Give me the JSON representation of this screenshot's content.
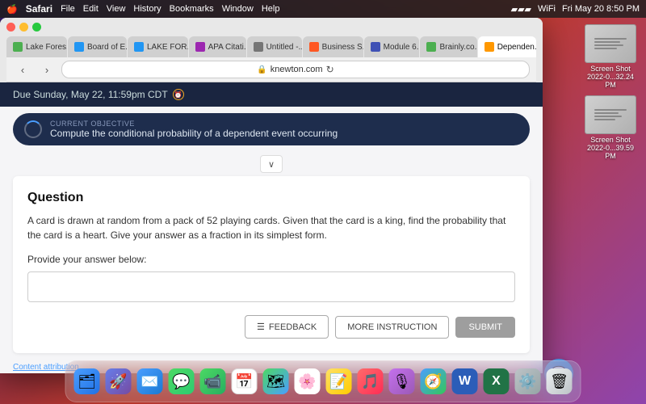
{
  "menubar": {
    "apple": "🍎",
    "app_name": "Safari",
    "menus": [
      "File",
      "Edit",
      "View",
      "History",
      "Bookmarks",
      "Window",
      "Help"
    ],
    "right_icons": [
      "battery",
      "wifi",
      "time"
    ],
    "time": "Fri May 20  8:50 PM"
  },
  "browser": {
    "tabs": [
      {
        "id": "lake",
        "label": "Lake Fores...",
        "active": false,
        "favicon_color": "#4CAF50"
      },
      {
        "id": "board",
        "label": "Board of E...",
        "active": false,
        "favicon_color": "#2196F3"
      },
      {
        "id": "lake2",
        "label": "LAKE FOR...",
        "active": false,
        "favicon_color": "#2196F3"
      },
      {
        "id": "apa",
        "label": "APA Citati...",
        "active": false,
        "favicon_color": "#9C27B0"
      },
      {
        "id": "untitled",
        "label": "Untitled -...",
        "active": false,
        "favicon_color": "#757575"
      },
      {
        "id": "business",
        "label": "Business S...",
        "active": false,
        "favicon_color": "#FF5722"
      },
      {
        "id": "module",
        "label": "Module 6...",
        "active": false,
        "favicon_color": "#3F51B5"
      },
      {
        "id": "brainly",
        "label": "Brainly.co...",
        "active": false,
        "favicon_color": "#4CAF50"
      },
      {
        "id": "depend",
        "label": "Dependen...",
        "active": true,
        "favicon_color": "#FF9800"
      }
    ],
    "address": "knewton.com",
    "lock": "🔒"
  },
  "page": {
    "due_label": "Due Sunday, May 22, 11:59pm CDT",
    "objective_label": "CURRENT OBJECTIVE",
    "objective_text": "Compute the conditional probability of a dependent event occurring",
    "chevron": "∨",
    "question": {
      "title": "Question",
      "body": "A card is drawn at random from a pack of 52 playing cards. Given that the card is a king, find the probability that the card is a heart. Give your answer as a fraction in its simplest form.",
      "provide_label": "Provide your answer below:",
      "answer_placeholder": "",
      "buttons": {
        "feedback": "FEEDBACK",
        "feedback_icon": "☰",
        "more_instruction": "MORE INSTRUCTION",
        "submit": "SUBMIT"
      }
    },
    "content_attribution": "Content attribution"
  },
  "dock": {
    "items": [
      {
        "name": "finder",
        "emoji": "🗂",
        "color": "#4a9eff"
      },
      {
        "name": "launchpad",
        "emoji": "🚀",
        "color": "#ff6b35"
      },
      {
        "name": "mail",
        "emoji": "✉️",
        "color": "#4a9eff"
      },
      {
        "name": "messages",
        "emoji": "💬",
        "color": "#4cd964"
      },
      {
        "name": "facetime",
        "emoji": "📹",
        "color": "#4cd964"
      },
      {
        "name": "calendar",
        "emoji": "📅",
        "color": "#ff3b30"
      },
      {
        "name": "maps",
        "emoji": "🗺",
        "color": "#4a9eff"
      },
      {
        "name": "photos",
        "emoji": "🖼",
        "color": "#ff9500"
      },
      {
        "name": "notes",
        "emoji": "📝",
        "color": "#ffcc00"
      },
      {
        "name": "music",
        "emoji": "🎵",
        "color": "#ff2d55"
      },
      {
        "name": "podcasts",
        "emoji": "🎙",
        "color": "#9b59b6"
      },
      {
        "name": "safari",
        "emoji": "🧭",
        "color": "#4a9eff"
      },
      {
        "name": "word",
        "emoji": "W",
        "color": "#2b5db8"
      },
      {
        "name": "excel",
        "emoji": "X",
        "color": "#217346"
      },
      {
        "name": "settings",
        "emoji": "⚙️",
        "color": "#999"
      },
      {
        "name": "trash",
        "emoji": "🗑",
        "color": "#999"
      }
    ]
  },
  "desktop_icons": [
    {
      "label": "Screen Shot 2022-0...32.24 PM",
      "id": "screenshot1"
    },
    {
      "label": "Screen Shot 2022-0...39.59 PM",
      "id": "screenshot2"
    }
  ],
  "chat_fab_icon": "💬"
}
